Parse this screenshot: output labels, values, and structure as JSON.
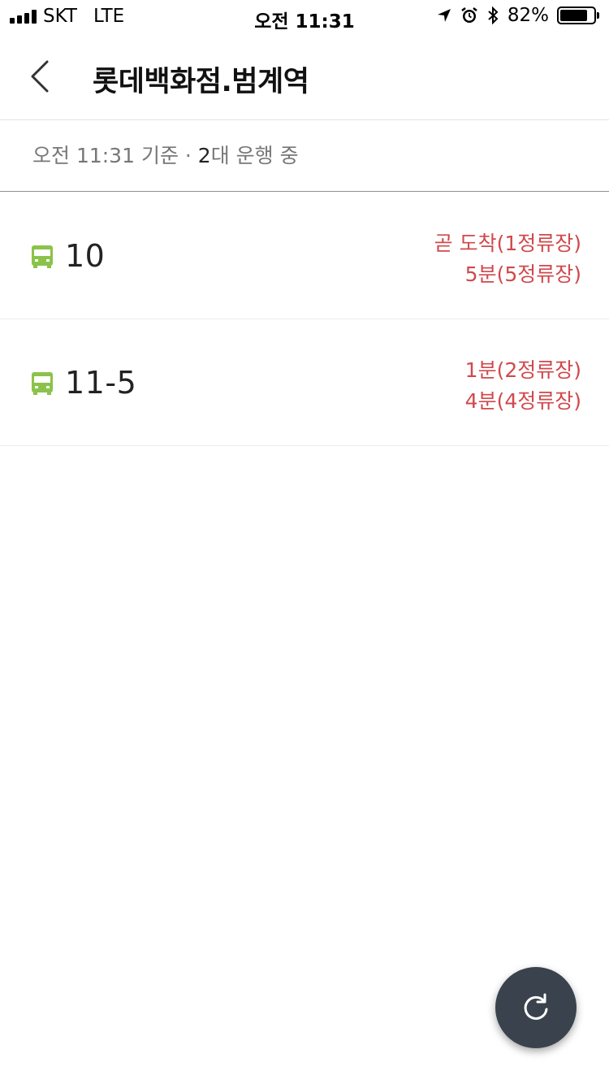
{
  "status_bar": {
    "carrier": "SKT",
    "network": "LTE",
    "time": "오전 11:31",
    "battery_percent": "82%",
    "battery_level": 0.82,
    "icons": [
      "signal-icon",
      "location-arrow-icon",
      "alarm-icon",
      "bluetooth-icon",
      "battery-icon"
    ]
  },
  "header": {
    "title": "롯데백화점.범계역",
    "back_icon": "chevron-left-icon"
  },
  "info": {
    "prefix": "오전 11:31 기준 · ",
    "count": "2",
    "suffix": "대 운행 중"
  },
  "routes": [
    {
      "number": "10",
      "icon": "bus-icon",
      "arrival_1": "곧 도착(1정류장)",
      "arrival_2": "5분(5정류장)"
    },
    {
      "number": "11-5",
      "icon": "bus-icon",
      "arrival_1": "1분(2정류장)",
      "arrival_2": "4분(4정류장)"
    }
  ],
  "colors": {
    "bus_green": "#8bc34a",
    "arrival_red": "#d0494c",
    "fab_bg": "#3a434d"
  },
  "fab": {
    "icon": "refresh-icon"
  }
}
